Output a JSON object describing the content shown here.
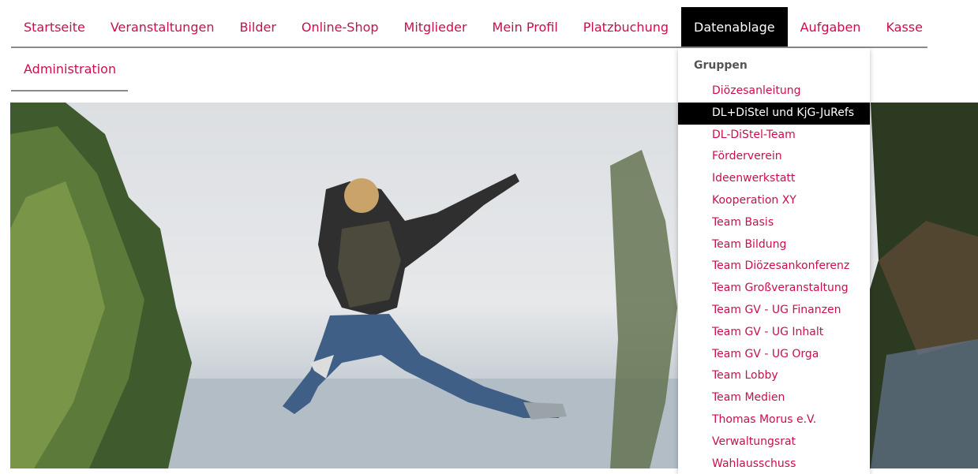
{
  "nav": {
    "items": [
      {
        "label": "Startseite"
      },
      {
        "label": "Veranstaltungen"
      },
      {
        "label": "Bilder"
      },
      {
        "label": "Online-Shop"
      },
      {
        "label": "Mitglieder"
      },
      {
        "label": "Mein Profil"
      },
      {
        "label": "Platzbuchung"
      },
      {
        "label": "Datenablage"
      },
      {
        "label": "Aufgaben"
      },
      {
        "label": "Kasse"
      }
    ],
    "second_row": {
      "label": "Administration"
    }
  },
  "dropdown": {
    "heading": "Gruppen",
    "items": [
      {
        "label": "Diözesanleitung"
      },
      {
        "label": "DL+DiStel und KjG-JuRefs"
      },
      {
        "label": "DL-DiStel-Team"
      },
      {
        "label": "Förderverein"
      },
      {
        "label": "Ideenwerkstatt"
      },
      {
        "label": "Kooperation XY"
      },
      {
        "label": "Team Basis"
      },
      {
        "label": "Team Bildung"
      },
      {
        "label": "Team Diözesankonferenz"
      },
      {
        "label": "Team Großveranstaltung"
      },
      {
        "label": "Team GV - UG Finanzen"
      },
      {
        "label": "Team GV - UG Inhalt"
      },
      {
        "label": "Team GV - UG Orga"
      },
      {
        "label": "Team Lobby"
      },
      {
        "label": "Team Medien"
      },
      {
        "label": "Thomas Morus e.V."
      },
      {
        "label": "Verwaltungsrat"
      },
      {
        "label": "Wahlausschuss"
      }
    ]
  },
  "colors": {
    "accent": "#c8104a",
    "active_bg": "#000000"
  }
}
